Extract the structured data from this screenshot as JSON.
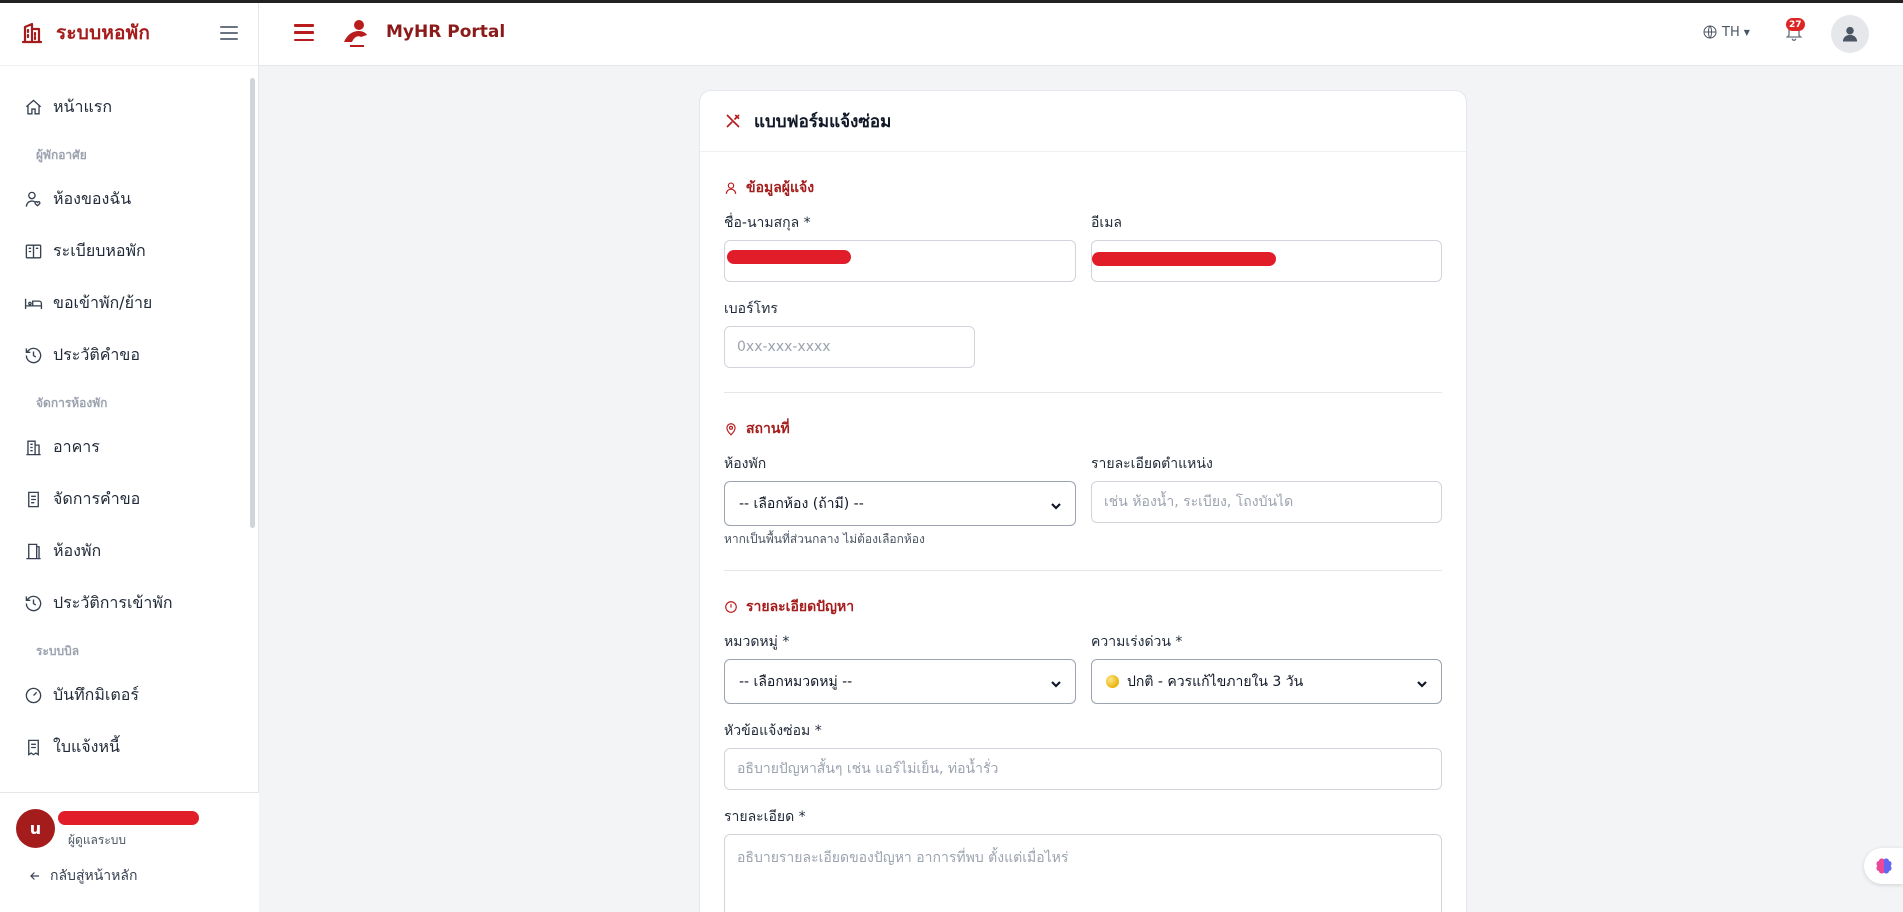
{
  "sidebar": {
    "brand_title": "ระบบหอพัก",
    "nav": [
      {
        "label": "หน้าแรก",
        "icon": "home-icon"
      },
      {
        "label": "ห้องของฉัน",
        "icon": "user-heart-icon"
      },
      {
        "label": "ระเบียบหอพัก",
        "icon": "book-icon"
      },
      {
        "label": "ขอเข้าพัก/ย้าย",
        "icon": "bed-icon"
      },
      {
        "label": "ประวัติคำขอ",
        "icon": "history-icon"
      },
      {
        "label": "อาคาร",
        "icon": "building-icon"
      },
      {
        "label": "จัดการคำขอ",
        "icon": "clipboard-icon"
      },
      {
        "label": "ห้องพัก",
        "icon": "door-icon"
      },
      {
        "label": "ประวัติการเข้าพัก",
        "icon": "history-icon"
      },
      {
        "label": "บันทึกมิเตอร์",
        "icon": "gauge-icon"
      },
      {
        "label": "ใบแจ้งหนี้",
        "icon": "invoice-icon"
      }
    ],
    "sections": {
      "resident": "ผู้พักอาศัย",
      "manage_rooms": "จัดการห้องพัก",
      "billing": "ระบบบิล"
    },
    "user": {
      "initial": "u",
      "role": "ผู้ดูแลระบบ",
      "back_label": "กลับสู่หน้าหลัก"
    }
  },
  "header": {
    "portal_title": "MyHR Portal",
    "language": "TH",
    "notification_count": "27"
  },
  "form": {
    "title": "แบบฟอร์มแจ้งซ่อม",
    "reporter": {
      "section_title": "ข้อมูลผู้แจ้ง",
      "name_label": "ชื่อ-นามสกุล *",
      "email_label": "อีเมล",
      "phone_label": "เบอร์โทร",
      "phone_placeholder": "0xx-xxx-xxxx"
    },
    "location": {
      "section_title": "สถานที่",
      "room_label": "ห้องพัก",
      "room_value": "-- เลือกห้อง (ถ้ามี) --",
      "room_hint": "หากเป็นพื้นที่ส่วนกลาง ไม่ต้องเลือกห้อง",
      "detail_label": "รายละเอียดตำแหน่ง",
      "detail_placeholder": "เช่น ห้องน้ำ, ระเบียง, โถงบันได"
    },
    "problem": {
      "section_title": "รายละเอียดปัญหา",
      "category_label": "หมวดหมู่ *",
      "category_value": "-- เลือกหมวดหมู่ --",
      "urgency_label": "ความเร่งด่วน *",
      "urgency_value": "ปกติ - ควรแก้ไขภายใน 3 วัน",
      "subject_label": "หัวข้อแจ้งซ่อม *",
      "subject_placeholder": "อธิบายปัญหาสั้นๆ เช่น แอร์ไม่เย็น, ท่อน้ำรั่ว",
      "detail_label": "รายละเอียด *",
      "detail_placeholder": "อธิบายรายละเอียดของปัญหา อาการที่พบ ตั้งแต่เมื่อไหร่"
    }
  },
  "colors": {
    "brand": "#a51c1c",
    "accent": "#b91c1c",
    "redaction": "#e11d2a"
  }
}
